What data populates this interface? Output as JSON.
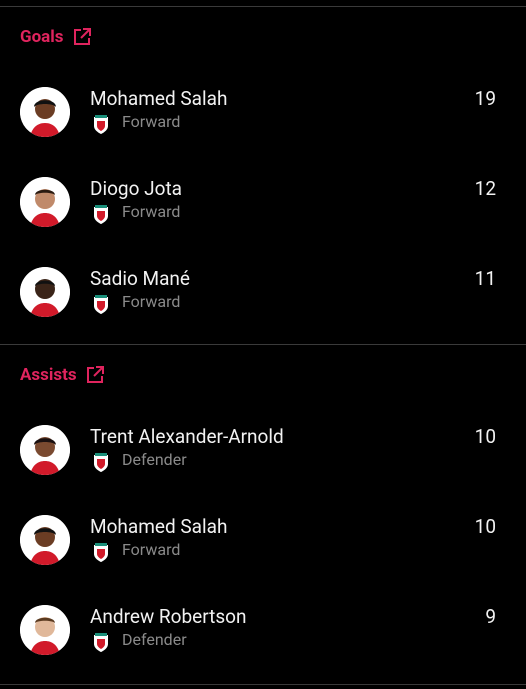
{
  "sections": [
    {
      "title": "Goals",
      "players": [
        {
          "name": "Mohamed Salah",
          "position": "Forward",
          "value": "19"
        },
        {
          "name": "Diogo Jota",
          "position": "Forward",
          "value": "12"
        },
        {
          "name": "Sadio Mané",
          "position": "Forward",
          "value": "11"
        }
      ]
    },
    {
      "title": "Assists",
      "players": [
        {
          "name": "Trent Alexander-Arnold",
          "position": "Defender",
          "value": "10"
        },
        {
          "name": "Mohamed Salah",
          "position": "Forward",
          "value": "10"
        },
        {
          "name": "Andrew Robertson",
          "position": "Defender",
          "value": "9"
        }
      ]
    }
  ],
  "colors": {
    "accent": "#e0245e",
    "kit_red": "#d11a2a",
    "background": "#000000"
  },
  "icons": {
    "external": "external-link-icon",
    "crest": "liverpool-crest-icon"
  }
}
